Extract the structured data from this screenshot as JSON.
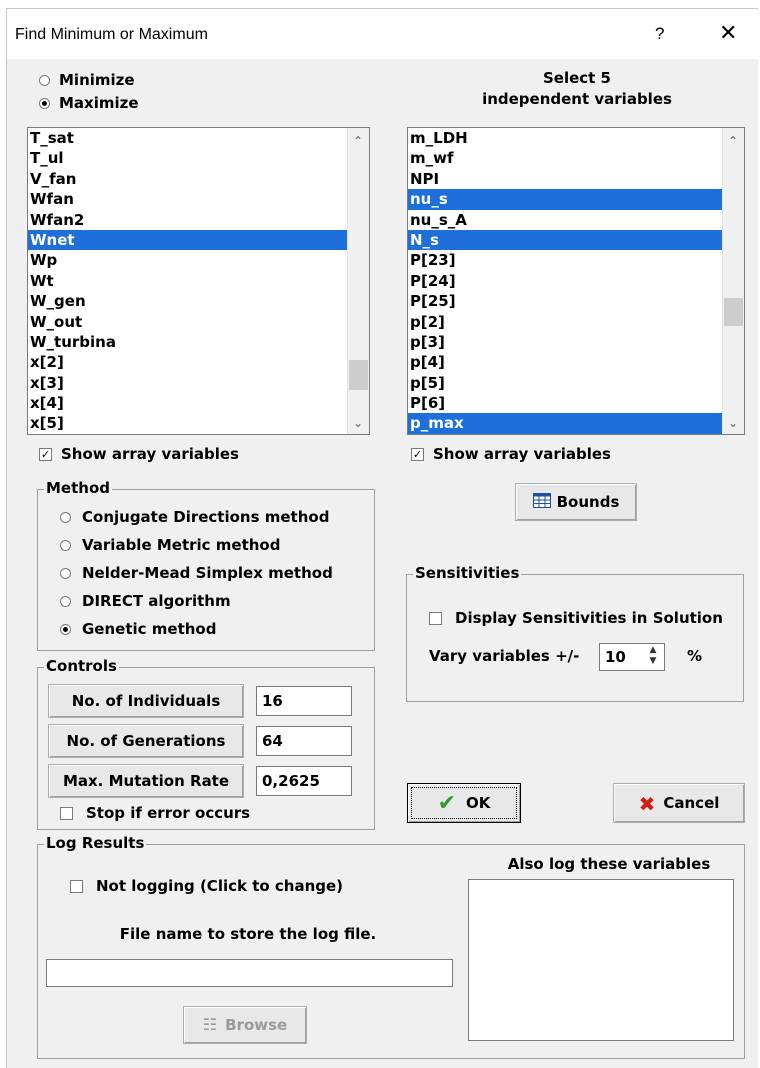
{
  "window": {
    "title": "Find Minimum or Maximum",
    "help": "?",
    "close": "✕"
  },
  "objective": {
    "minimize": "Minimize",
    "maximize": "Maximize",
    "selected": "Maximize"
  },
  "right_header": {
    "line1": "Select 5",
    "line2": "independent variables"
  },
  "left_list": {
    "items": [
      "T_sat",
      "T_ul",
      "V_fan",
      "Wfan",
      "Wfan2",
      "Wnet",
      "Wp",
      "Wt",
      "W_gen",
      "W_out",
      "W_turbina",
      "x[2]",
      "x[3]",
      "x[4]",
      "x[5]"
    ],
    "selected": [
      "Wnet"
    ],
    "show_array_label": "Show array variables",
    "show_array_checked": true
  },
  "right_list": {
    "items": [
      "m_LDH",
      "m_wf",
      "NPI",
      "nu_s",
      "nu_s_A",
      "N_s",
      "P[23]",
      "P[24]",
      "P[25]",
      "p[2]",
      "p[3]",
      "p[4]",
      "p[5]",
      "P[6]",
      "p_max"
    ],
    "selected": [
      "nu_s",
      "N_s",
      "p_max"
    ],
    "show_array_label": "Show array variables",
    "show_array_checked": true
  },
  "bounds_button": "Bounds",
  "method": {
    "label": "Method",
    "options": [
      "Conjugate Directions method",
      "Variable Metric method",
      "Nelder-Mead Simplex method",
      "DIRECT algorithm",
      "Genetic method"
    ],
    "selected": "Genetic method"
  },
  "sensitivities": {
    "label": "Sensitivities",
    "display_label": "Display Sensitivities in Solution",
    "display_checked": false,
    "vary_label": "Vary variables +/-",
    "vary_value": "10",
    "unit": "%"
  },
  "controls": {
    "label": "Controls",
    "individuals_label": "No. of Individuals",
    "individuals_value": "16",
    "generations_label": "No. of Generations",
    "generations_value": "64",
    "mutation_label": "Max. Mutation Rate",
    "mutation_value": "0,2625",
    "stop_label": "Stop if error occurs",
    "stop_checked": false
  },
  "ok_button": "OK",
  "cancel_button": "Cancel",
  "log": {
    "label": "Log Results",
    "not_logging_label": "Not logging (Click to change)",
    "file_label": "File name to store the log file.",
    "file_value": "",
    "browse_button": "Browse",
    "also_log_label": "Also log these variables"
  },
  "colors": {
    "selection": "#1e6fd9",
    "face": "#f0f0f0",
    "ok_check": "#2e9d2e",
    "cancel_x": "#d02010"
  }
}
